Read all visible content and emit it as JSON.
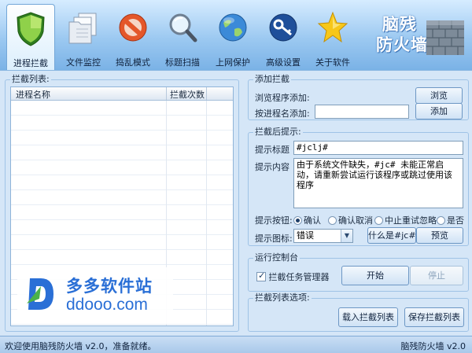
{
  "toolbar": {
    "items": [
      {
        "label": "进程拦截",
        "icon": "shield-icon"
      },
      {
        "label": "文件监控",
        "icon": "documents-icon"
      },
      {
        "label": "捣乱模式",
        "icon": "prohibit-icon"
      },
      {
        "label": "标题扫描",
        "icon": "magnifier-icon"
      },
      {
        "label": "上网保护",
        "icon": "globe-icon"
      },
      {
        "label": "高级设置",
        "icon": "key-icon"
      },
      {
        "label": "关于软件",
        "icon": "star-icon"
      }
    ],
    "brand": {
      "line1": "脑残",
      "line2": "防火墙"
    }
  },
  "intercept_list": {
    "group_title": "拦截列表:",
    "columns": [
      "进程名称",
      "拦截次数"
    ],
    "rows": []
  },
  "add_intercept": {
    "group_title": "添加拦截",
    "program_label": "浏览程序添加:",
    "browse_button": "浏览",
    "process_label": "按进程名添加:",
    "process_value": "",
    "add_button": "添加"
  },
  "prompt": {
    "group_title": "拦截后提示:",
    "title_label": "提示标题",
    "title_value": "#jclj#",
    "content_label": "提示内容",
    "content_value": "由于系统文件缺失，#jc# 未能正常启动，请重新尝试运行该程序或跳过使用该程序",
    "button_label": "提示按钮:",
    "radios": [
      {
        "label": "确认",
        "checked": true
      },
      {
        "label": "确认取消",
        "checked": false
      },
      {
        "label": "中止重试忽略",
        "checked": false
      },
      {
        "label": "是否",
        "checked": false
      }
    ],
    "icon_label": "提示图标:",
    "icon_value": "错误",
    "what_button": "什么是#jc#",
    "preview_button": "预览"
  },
  "console": {
    "group_title": "运行控制台",
    "checkbox_label": "拦截任务管理器",
    "checkbox_checked": true,
    "start_button": "开始",
    "stop_button": "停止"
  },
  "list_options": {
    "group_title": "拦截列表选项:",
    "load_button": "载入拦截列表",
    "save_button": "保存拦截列表"
  },
  "status": {
    "left": "欢迎使用脑残防火墙 v2.0，准备就绪。",
    "right": "脑残防火墙 v2.0"
  },
  "watermark": {
    "cn": "多多软件站",
    "url": "ddooo.com"
  },
  "colors": {
    "toolbar_top": "#d6ecff",
    "toolbar_bottom": "#7ab2e6",
    "panel_bg": "#d5e6f7",
    "watermark_blue": "#2a6fd6",
    "watermark_green": "#4bb24a"
  }
}
